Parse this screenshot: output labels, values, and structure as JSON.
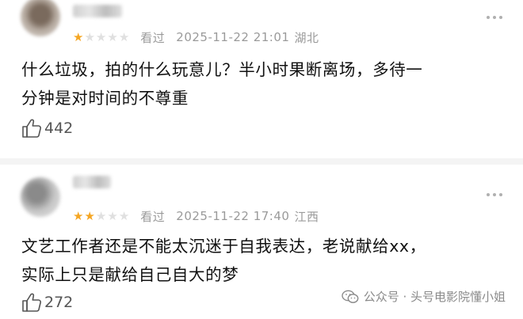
{
  "reviews": [
    {
      "rating_filled": 1,
      "rating_total": 5,
      "status": "看过",
      "datetime": "2025-11-22 21:01",
      "location": "湖北",
      "content_line1": "什么垃圾，拍的什么玩意儿？半小时果断离场，多待一",
      "content_line2": "分钟是对时间的不尊重",
      "likes": "442"
    },
    {
      "rating_filled": 2,
      "rating_total": 5,
      "status": "看过",
      "datetime": "2025-11-22 17:40",
      "location": "江西",
      "content_line1": "文艺工作者还是不能太沉迷于自我表达，老说献给xx，",
      "content_line2": "实际上只是献给自己自大的梦",
      "likes": "272"
    }
  ],
  "watermark": {
    "text": "公众号 · 头号电影院懂小姐"
  },
  "colors": {
    "star_filled": "#f5a623",
    "star_empty": "#e0e0e0",
    "meta_gray": "#9a9a9a"
  }
}
